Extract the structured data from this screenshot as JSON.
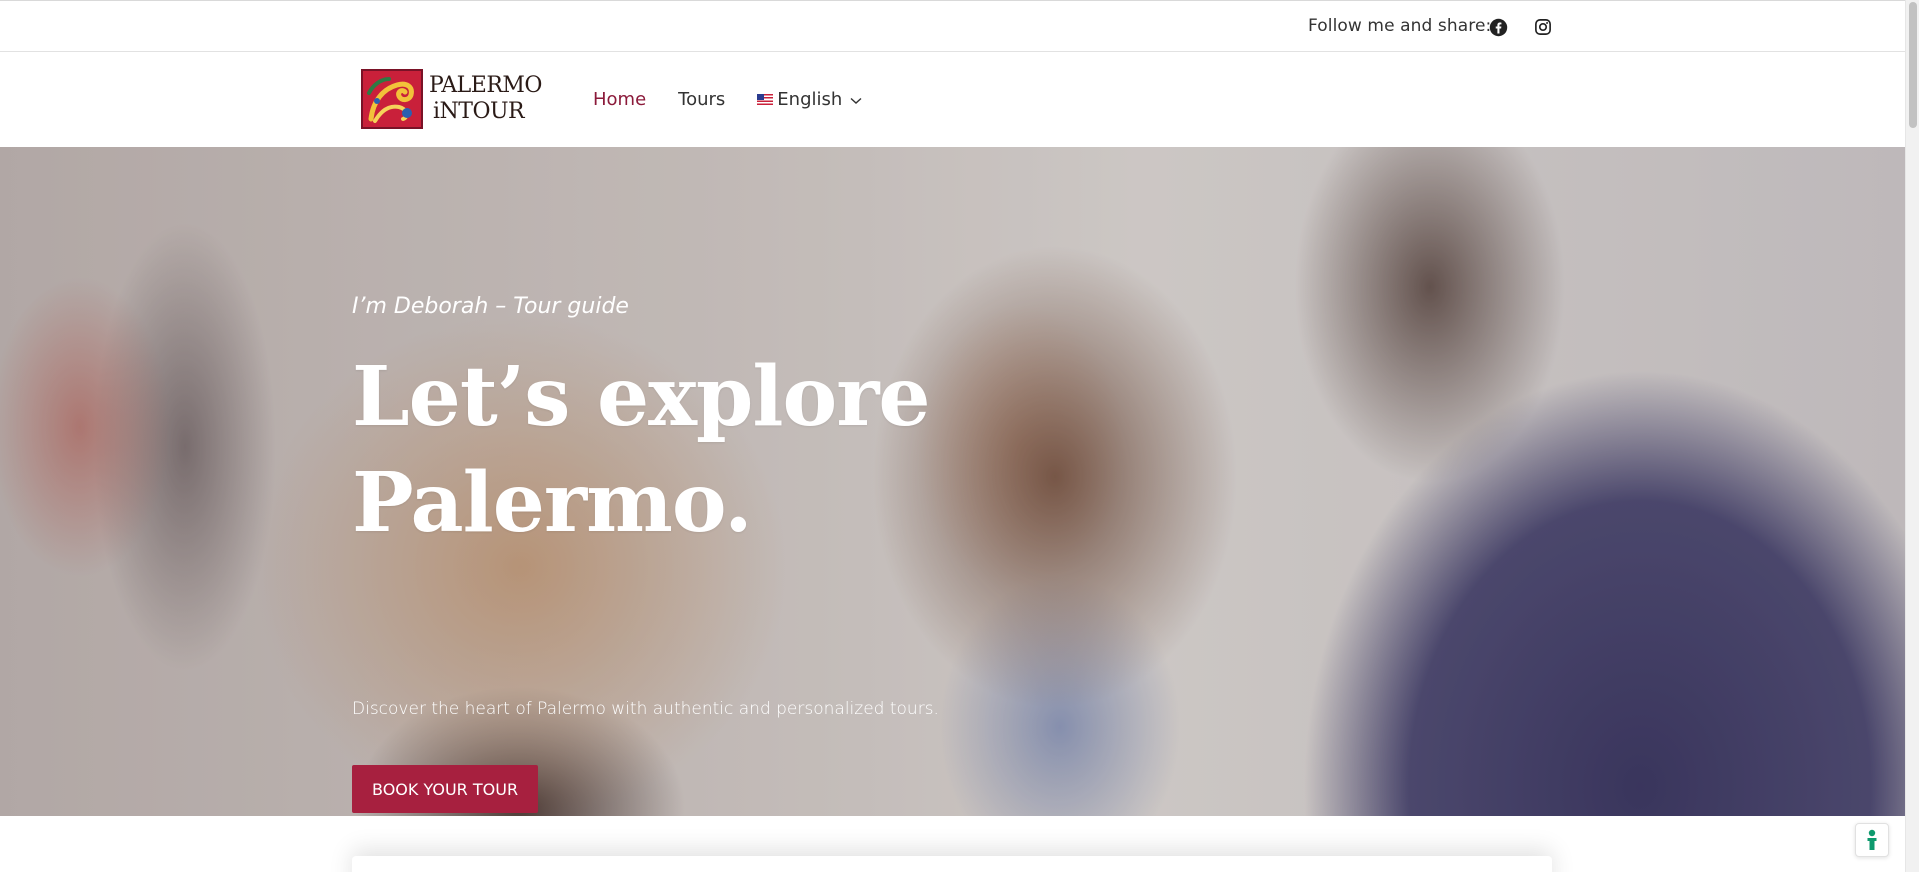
{
  "topbar": {
    "follow_text": "Follow me and share:",
    "social": [
      {
        "name": "facebook",
        "icon": "facebook-icon"
      },
      {
        "name": "instagram",
        "icon": "instagram-icon"
      }
    ]
  },
  "header": {
    "logo_line1": "PALERMO",
    "logo_line2": "iNTOUR",
    "nav": [
      {
        "label": "Home",
        "active": true
      },
      {
        "label": "Tours",
        "active": false
      }
    ],
    "language": {
      "label": "English",
      "flag_icon": "us-flag-icon",
      "chevron_icon": "chevron-down-icon"
    }
  },
  "hero": {
    "subtitle": "I’m Deborah – Tour guide",
    "title_line1": "Let’s explore",
    "title_line2": "Palermo.",
    "description": "Discover the heart of Palermo with authentic and personalized tours.",
    "cta_label": "BOOK YOUR TOUR"
  },
  "colors": {
    "accent": "#a7203f",
    "nav_active": "#8b1a3a",
    "text": "#333333",
    "cookie_icon": "#0e9a6e"
  },
  "cookie_button": {
    "icon": "cookie-settings-icon"
  }
}
